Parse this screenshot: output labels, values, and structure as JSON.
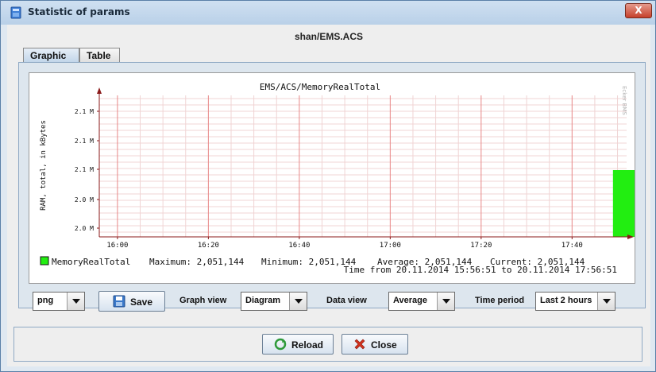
{
  "window": {
    "title": "Statistic of params",
    "close_label": "X"
  },
  "header": {
    "path": "shan/EMS.ACS"
  },
  "tabs": [
    {
      "label": "Graphic",
      "active": true
    },
    {
      "label": "Table",
      "active": false
    }
  ],
  "chart": {
    "title": "EMS/ACS/MemoryRealTotal",
    "watermark": "Ecker BMS",
    "ylabel": "RAM, total, in kBytes",
    "legend": {
      "name": "MemoryRealTotal",
      "maximum": "Maximum: 2,051,144",
      "minimum": "Minimum: 2,051,144",
      "average": "Average: 2,051,144",
      "current": "Current: 2,051,144"
    },
    "time_range": "Time from 20.11.2014 15:56:51 to 20.11.2014 17:56:51",
    "bar_color": "#22ee11",
    "grid_major_color": "#e88888",
    "grid_minor_color": "#f0d4d4"
  },
  "chart_data": {
    "type": "bar",
    "title": "EMS/ACS/MemoryRealTotal",
    "ylabel": "RAM, total, in kBytes",
    "xlabel": "",
    "x_ticks": [
      "16:00",
      "16:20",
      "16:40",
      "17:00",
      "17:20",
      "17:40"
    ],
    "y_ticks": [
      "2.0 M",
      "2.0 M",
      "2.1 M",
      "2.1 M",
      "2.1 M"
    ],
    "series": [
      {
        "name": "MemoryRealTotal",
        "values": [
          2051144
        ],
        "x": [
          "17:51"
        ]
      }
    ],
    "grid": true,
    "legend": "bottom-left"
  },
  "controls": {
    "format_value": "png",
    "save_label": "Save",
    "graph_view_label": "Graph view",
    "graph_view_value": "Diagram",
    "data_view_label": "Data view",
    "data_view_value": "Average",
    "time_period_label": "Time period",
    "time_period_value": "Last 2 hours"
  },
  "footer": {
    "reload_label": "Reload",
    "close_label": "Close"
  }
}
